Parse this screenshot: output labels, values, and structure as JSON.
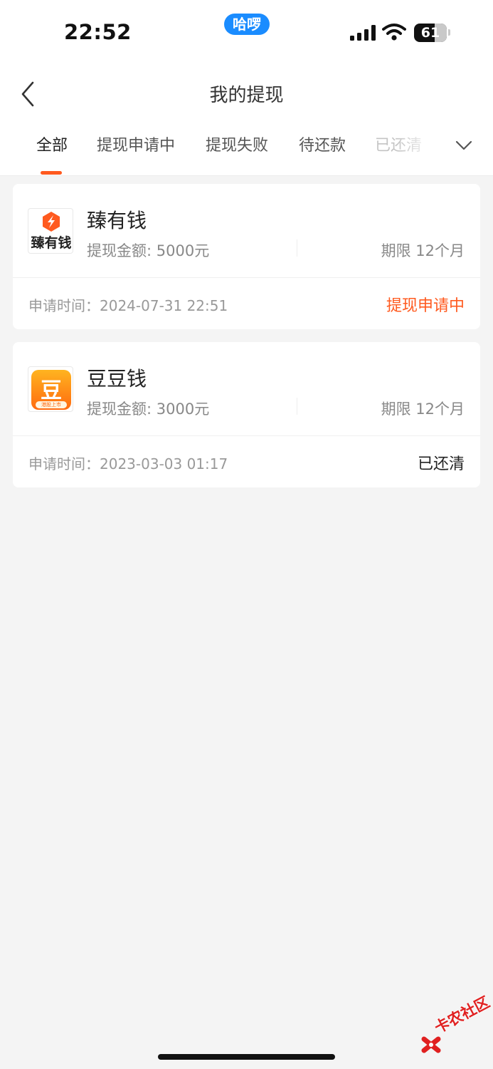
{
  "status_bar": {
    "time": "22:52",
    "pill_label": "哈啰",
    "battery_level": "61",
    "pill_color": "#1a8cff"
  },
  "nav": {
    "title": "我的提现",
    "back_icon": "chevron-left-icon"
  },
  "tabs": [
    {
      "label": "全部",
      "active": true
    },
    {
      "label": "提现申请中",
      "active": false
    },
    {
      "label": "提现失败",
      "active": false
    },
    {
      "label": "待还款",
      "active": false
    },
    {
      "label": "已还清",
      "active": false
    }
  ],
  "tabs_more_icon": "chevron-down-icon",
  "records": [
    {
      "name": "臻有钱",
      "logo_text": "臻有钱",
      "amount": "提现金额: 5000元",
      "term": "期限 12个月",
      "apply_time": "申请时间：2024-07-31 22:51",
      "status": "提现申请中",
      "status_color": "#ff5a1f"
    },
    {
      "name": "豆豆钱",
      "logo_text": "豆",
      "logo_subtext": "港股上市",
      "amount": "提现金额: 3000元",
      "term": "期限 12个月",
      "apply_time": "申请时间：2023-03-03 01:17",
      "status": "已还清",
      "status_color": "#222222"
    }
  ],
  "watermark": {
    "text": "卡农社区"
  },
  "colors": {
    "accent": "#ff5a1f",
    "background": "#f4f4f4"
  }
}
